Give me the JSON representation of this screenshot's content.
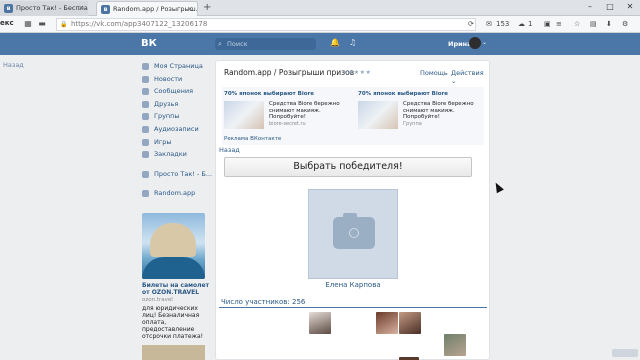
{
  "browser": {
    "tabs": [
      {
        "label": "Просто Так! - Бесплатно..."
      },
      {
        "label": "Random.app / Розыгрыш..."
      }
    ],
    "new_tab": "+",
    "window_controls": {
      "minimize": "–",
      "maximize": "□",
      "close": "✕"
    },
    "brand_fragment": "екс",
    "url": "https://vk.com/app3407122_13206178",
    "mail_count": "153",
    "weather_count": "1"
  },
  "vk_header": {
    "logo": "ВК",
    "search_placeholder": "Поиск",
    "user_name": "Ирина"
  },
  "left_back": "Назад",
  "menu": {
    "items": [
      {
        "label": "Моя Страница"
      },
      {
        "label": "Новости"
      },
      {
        "label": "Сообщения"
      },
      {
        "label": "Друзья"
      },
      {
        "label": "Группы"
      },
      {
        "label": "Аудиозаписи"
      },
      {
        "label": "Игры"
      },
      {
        "label": "Закладки"
      },
      {
        "label": "Просто Так! - Б..."
      },
      {
        "label": "Random.app"
      }
    ]
  },
  "sidebar_ad": {
    "title": "Билеты на самолет от OZON.TRAVEL",
    "domain": "ozon.travel",
    "text": "для юридических лиц! Безналичная оплата, предоставление отсрочки платежа!"
  },
  "app": {
    "title": "Random.app / Розыгрыши призов",
    "stars": "★★★★★",
    "help": "Помощь",
    "actions": "Действия ⌄",
    "ads": [
      {
        "headline": "70% японок выбирают Biore",
        "text": "Средства Biore бережно снимают макияж. Попробуйте!",
        "domain": "biore-secret.ru"
      },
      {
        "headline": "70% японок выбирают Biore",
        "text": "Средства Biore бережно снимают макияж. Попробуйте!",
        "domain": "Группа"
      }
    ],
    "vk_ads_label": "Реклама ВКонтакте",
    "back": "Назад",
    "choose_button": "Выбрать победителя!",
    "winner_name": "Елена Карпова",
    "participants_label": "Число участников: 256"
  }
}
